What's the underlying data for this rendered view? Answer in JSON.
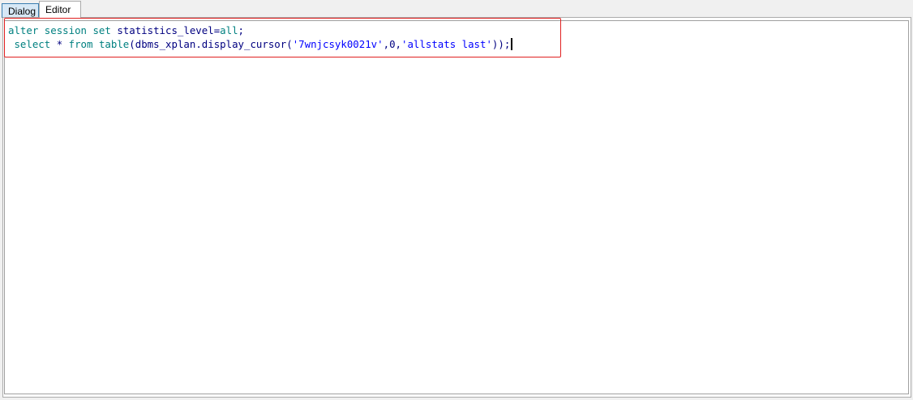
{
  "tabs": {
    "dialog": "Dialog",
    "editor": "Editor"
  },
  "editor": {
    "line1": {
      "kw_alter": "alter",
      "kw_session": "session",
      "kw_set": "set",
      "param": "statistics_level",
      "eq": "=",
      "kw_all": "all",
      "end": ";"
    },
    "line2": {
      "indent": " ",
      "kw_select": "select",
      "star": "*",
      "kw_from": "from",
      "kw_table": "table",
      "open_paren": "(",
      "func": "dbms_xplan.display_cursor",
      "open_paren2": "(",
      "sql_id": "'7wnjcsyk0021v'",
      "comma1": ",",
      "child": "0",
      "comma2": ",",
      "format": "'allstats last'",
      "close": "));"
    }
  },
  "colors": {
    "keyword": "#008080",
    "string": "#0000ff",
    "identifier": "#000080",
    "highlight_border": "#e02020",
    "active_tab_bg": "#ffffff",
    "inactive_tab_bg": "#d7e8f6"
  }
}
